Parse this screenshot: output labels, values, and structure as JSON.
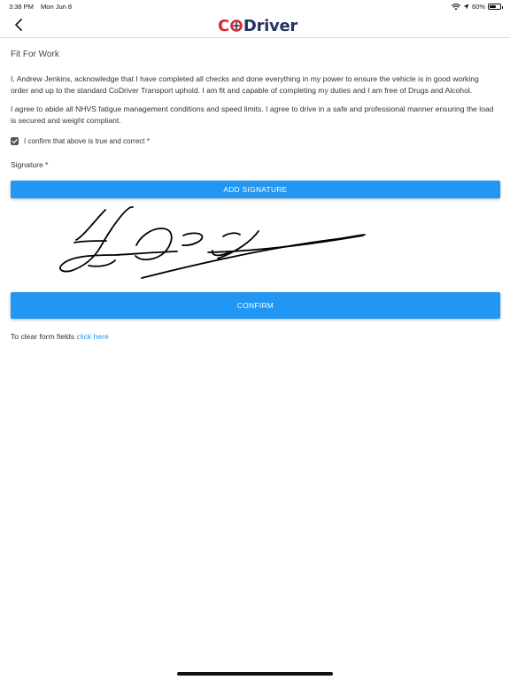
{
  "status_bar": {
    "time": "3:38 PM",
    "date": "Mon Jun 8",
    "battery": "60%",
    "battery_level": 0.6
  },
  "nav": {
    "logo_c": "C",
    "logo_rest": "Driver"
  },
  "form": {
    "title": "Fit For Work",
    "paragraph1": "I, Andrew Jenkins, acknowledge that I have completed all checks and done everything in my power to ensure the vehicle is in good working order and up to the standard CoDriver Transport uphold. I am fit and capable of completing my duties and I am free of Drugs and Alcohol.",
    "paragraph2": "I agree to abide all NHVS fatigue management conditions and speed limits. I agree to drive in a safe and professional manner ensuring the load is secured and weight compliant.",
    "confirm_label": "I confirm that above is true and correct *",
    "confirm_checked": true,
    "signature_label": "Signature *",
    "add_signature_button": "ADD SIGNATURE",
    "confirm_button": "CONFIRM",
    "clear_text": "To clear form fields",
    "clear_link": "click here"
  },
  "colors": {
    "accent": "#2196f3",
    "logo_red": "#d9232e",
    "logo_navy": "#24335f"
  }
}
